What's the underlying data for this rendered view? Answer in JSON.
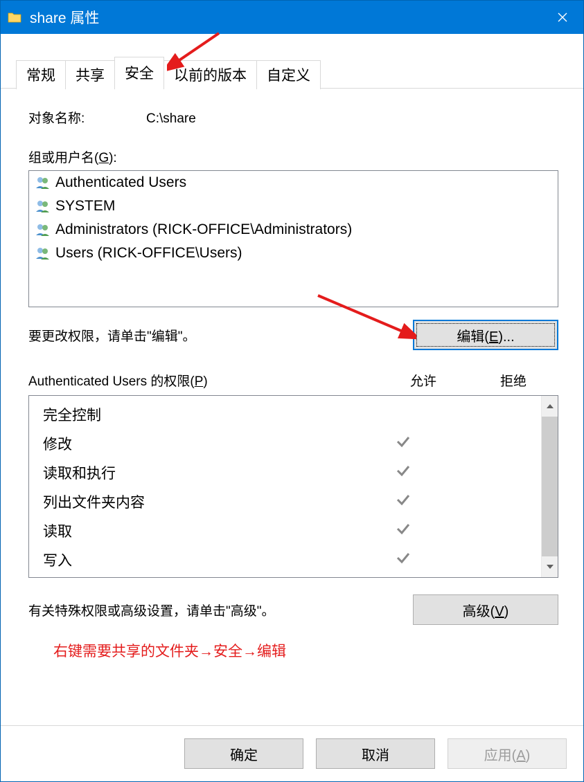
{
  "titlebar": {
    "title": "share 属性"
  },
  "tabs": {
    "t0": "常规",
    "t1": "共享",
    "t2": "安全",
    "t3": "以前的版本",
    "t4": "自定义"
  },
  "object_label": "对象名称:",
  "object_value": "C:\\share",
  "group_label_prefix": "组或用户名(",
  "group_label_key": "G",
  "group_label_suffix": "):",
  "groups": {
    "g0": "Authenticated Users",
    "g1": "SYSTEM",
    "g2": "Administrators (RICK-OFFICE\\Administrators)",
    "g3": "Users (RICK-OFFICE\\Users)"
  },
  "edit_hint": "要更改权限，请单击\"编辑\"。",
  "edit_btn_prefix": "编辑(",
  "edit_btn_key": "E",
  "edit_btn_suffix": ")...",
  "perm_header_prefix": "Authenticated Users 的权限(",
  "perm_header_key": "P",
  "perm_header_suffix": ")",
  "perm_allow": "允许",
  "perm_deny": "拒绝",
  "permissions": {
    "p0": {
      "name": "完全控制",
      "allow": false,
      "deny": false
    },
    "p1": {
      "name": "修改",
      "allow": true,
      "deny": false
    },
    "p2": {
      "name": "读取和执行",
      "allow": true,
      "deny": false
    },
    "p3": {
      "name": "列出文件夹内容",
      "allow": true,
      "deny": false
    },
    "p4": {
      "name": "读取",
      "allow": true,
      "deny": false
    },
    "p5": {
      "name": "写入",
      "allow": true,
      "deny": false
    }
  },
  "adv_hint": "有关特殊权限或高级设置，请单击\"高级\"。",
  "adv_btn_prefix": "高级(",
  "adv_btn_key": "V",
  "adv_btn_suffix": ")",
  "annotation_text": "右键需要共享的文件夹→安全→编辑",
  "footer": {
    "ok": "确定",
    "cancel": "取消",
    "apply_prefix": "应用(",
    "apply_key": "A",
    "apply_suffix": ")"
  }
}
